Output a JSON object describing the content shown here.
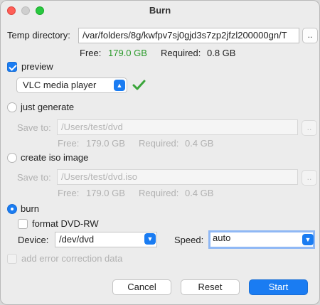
{
  "window": {
    "title": "Burn"
  },
  "temp": {
    "label": "Temp directory:",
    "path": "/var/folders/8g/kwfpv7sj0gjd3s7zp2jfzl200000gn/T",
    "browse": "..",
    "free_label": "Free:",
    "free_value": "179.0 GB",
    "required_label": "Required:",
    "required_value": "0.8 GB"
  },
  "preview": {
    "label": "preview",
    "checked": true,
    "player": "VLC media player",
    "status_icon": "green-checkmark-icon",
    "status_color": "#3aa53a"
  },
  "generate": {
    "label": "just generate",
    "save_label": "Save to:",
    "path": "/Users/test/dvd",
    "browse": "..",
    "free_label": "Free:",
    "free_value": "179.0 GB",
    "required_label": "Required:",
    "required_value": "0.4 GB"
  },
  "iso": {
    "label": "create iso image",
    "save_label": "Save to:",
    "path": "/Users/test/dvd.iso",
    "browse": "..",
    "free_label": "Free:",
    "free_value": "179.0 GB",
    "required_label": "Required:",
    "required_value": "0.4 GB"
  },
  "burn": {
    "label": "burn",
    "selected": true,
    "format_label": "format DVD-RW",
    "device_label": "Device:",
    "device_value": "/dev/dvd",
    "speed_label": "Speed:",
    "speed_value": "auto",
    "error_correction_label": "add error correction data"
  },
  "buttons": {
    "cancel": "Cancel",
    "reset": "Reset",
    "start": "Start"
  },
  "colors": {
    "accent": "#1a7cf2",
    "free_value": "#2a9a2a"
  }
}
